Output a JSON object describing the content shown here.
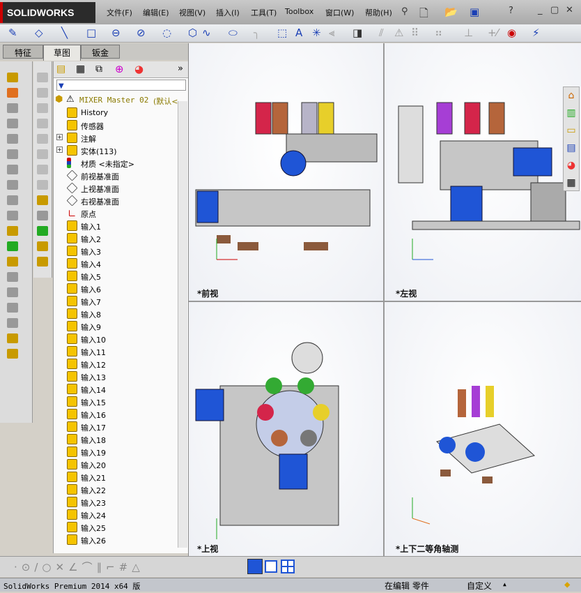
{
  "app": {
    "logo": "SOLIDWORKS"
  },
  "menu": [
    "文件(F)",
    "编辑(E)",
    "视图(V)",
    "插入(I)",
    "工具(T)",
    "Toolbox",
    "窗口(W)",
    "帮助(H)"
  ],
  "tabs": [
    "特征",
    "草图",
    "钣金"
  ],
  "tree": {
    "root": "MIXER Master 02",
    "root_config": "(默认<",
    "items": [
      {
        "label": "History",
        "icon": "history-folder-icon",
        "expand": false
      },
      {
        "label": "传感器",
        "icon": "sensor-folder-icon",
        "expand": false
      },
      {
        "label": "注解",
        "icon": "annotation-folder-icon",
        "expand": true
      },
      {
        "label": "实体(113)",
        "icon": "solid-bodies-folder-icon",
        "expand": true
      },
      {
        "label": "材质 <未指定>",
        "icon": "material-icon",
        "expand": false
      },
      {
        "label": "前视基准面",
        "icon": "plane-icon",
        "expand": false
      },
      {
        "label": "上视基准面",
        "icon": "plane-icon",
        "expand": false
      },
      {
        "label": "右视基准面",
        "icon": "plane-icon",
        "expand": false
      },
      {
        "label": "原点",
        "icon": "origin-icon",
        "expand": false
      },
      {
        "label": "输入1"
      },
      {
        "label": "输入2"
      },
      {
        "label": "输入3"
      },
      {
        "label": "输入4"
      },
      {
        "label": "输入5"
      },
      {
        "label": "输入6"
      },
      {
        "label": "输入7"
      },
      {
        "label": "输入8"
      },
      {
        "label": "输入9"
      },
      {
        "label": "输入10"
      },
      {
        "label": "输入11"
      },
      {
        "label": "输入12"
      },
      {
        "label": "输入13"
      },
      {
        "label": "输入14"
      },
      {
        "label": "输入15"
      },
      {
        "label": "输入16"
      },
      {
        "label": "输入17"
      },
      {
        "label": "输入18"
      },
      {
        "label": "输入19"
      },
      {
        "label": "输入20"
      },
      {
        "label": "输入21"
      },
      {
        "label": "输入22"
      },
      {
        "label": "输入23"
      },
      {
        "label": "输入24"
      },
      {
        "label": "输入25"
      },
      {
        "label": "输入26"
      }
    ]
  },
  "viewports": {
    "front": "*前视",
    "left": "*左视",
    "top": "*上视",
    "iso": "*上下二等角轴测"
  },
  "status": {
    "version": "SolidWorks Premium 2014 x64 版",
    "mode": "在编辑 零件",
    "units": "自定义",
    "units_arrow": "▲"
  },
  "colors": {
    "accent": "#1a3fb5",
    "logo_bg": "#2b2b2b",
    "machine_blue": "#1f55d6"
  }
}
